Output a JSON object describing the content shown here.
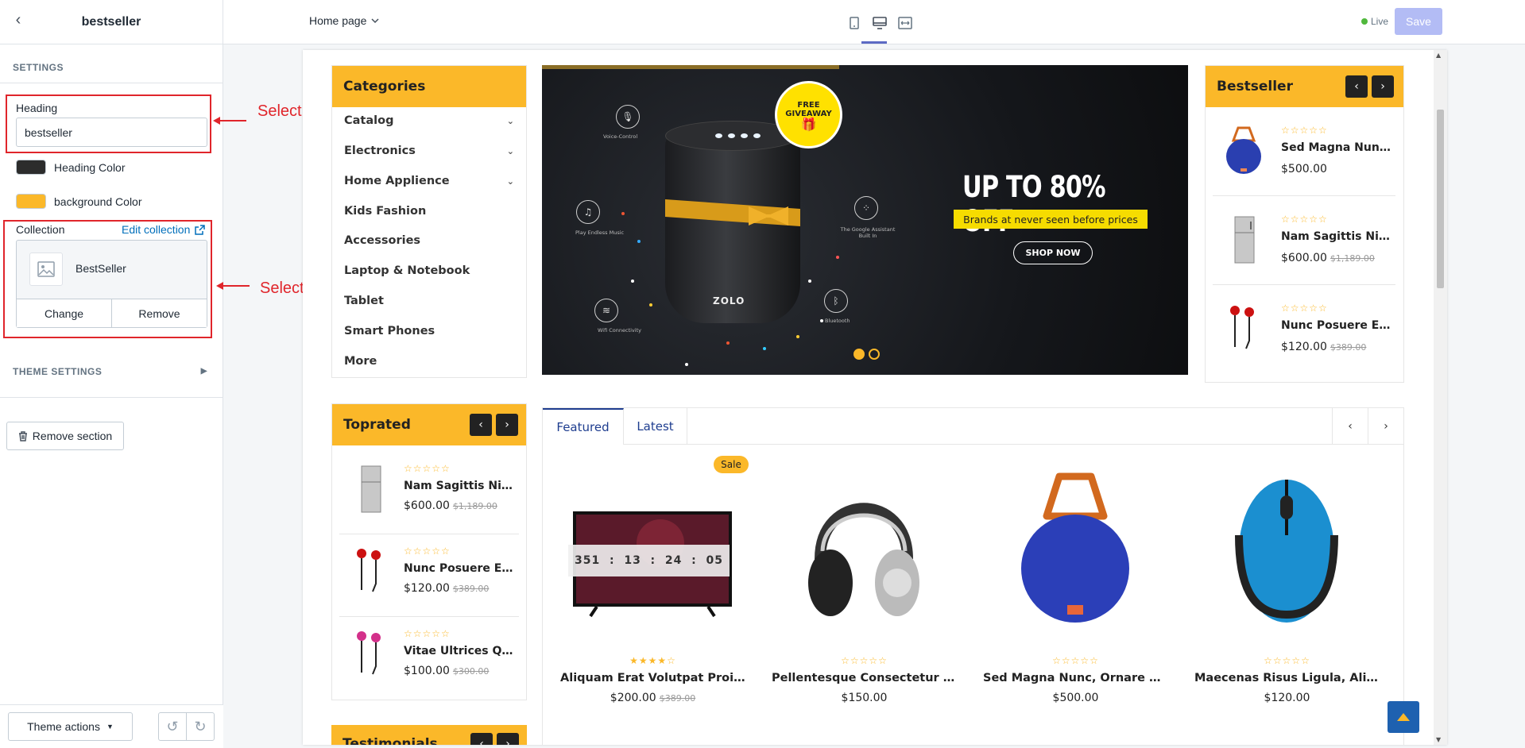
{
  "sidebar": {
    "back_icon": "chevron-left-icon",
    "title": "bestseller",
    "section_label": "SETTINGS",
    "heading_label": "Heading",
    "heading_value": "bestseller",
    "heading_color_label": "Heading Color",
    "heading_color": "#2c2c2c",
    "bg_color_label": "background Color",
    "bg_color": "#fbb829",
    "collection_label": "Collection",
    "edit_collection": "Edit collection",
    "collection_name": "BestSeller",
    "change": "Change",
    "remove": "Remove",
    "theme_settings": "THEME SETTINGS",
    "remove_section": "Remove section",
    "theme_actions": "Theme actions"
  },
  "annotations": {
    "heading": "Select Heading for product",
    "collection": "Select Collection for bestseller",
    "color": "#e0252b"
  },
  "topbar": {
    "page": "Home page",
    "live": "Live",
    "save": "Save",
    "devices": [
      "mobile-icon",
      "desktop-icon",
      "fullwidth-icon"
    ],
    "active_device": "desktop-icon",
    "accent": "#5c6ac4"
  },
  "store": {
    "accent": "#fbb829",
    "categories": {
      "title": "Categories",
      "items": [
        {
          "label": "Catalog",
          "has_sub": true
        },
        {
          "label": "Electronics",
          "has_sub": true
        },
        {
          "label": "Home Applience",
          "has_sub": true
        },
        {
          "label": "Kids Fashion",
          "has_sub": false
        },
        {
          "label": "Accessories",
          "has_sub": false
        },
        {
          "label": "Laptop & Notebook",
          "has_sub": false
        },
        {
          "label": "Tablet",
          "has_sub": false
        },
        {
          "label": "Smart Phones",
          "has_sub": false
        },
        {
          "label": "More",
          "has_sub": false
        }
      ]
    },
    "banner": {
      "giveaway_line1": "FREE",
      "giveaway_line2": "GIVEAWAY",
      "headline": "UP TO 80% OFF",
      "subline": "Brands at never seen before prices",
      "cta": "SHOP NOW",
      "brand": "ZOLO",
      "features": [
        "Voice-Control",
        "Play Endless Music",
        "Wifi Connectivity",
        "The Google Assistant Built In",
        "Bluetooth"
      ],
      "slide_count": 2,
      "active_slide": 1
    },
    "bestseller": {
      "title": "Bestseller",
      "products": [
        {
          "name": "Sed Magna Nunc, Ornare Con...",
          "price": "$500.00",
          "old_price": "",
          "rating": 0,
          "image": "jbl-speaker"
        },
        {
          "name": "Nam Sagittis Nibh Euismod",
          "price": "$600.00",
          "old_price": "$1,189.00",
          "rating": 0,
          "image": "refrigerator"
        },
        {
          "name": "Nunc Posuere Erat Viverra",
          "price": "$120.00",
          "old_price": "$389.00",
          "rating": 0,
          "image": "earphones-red"
        }
      ]
    },
    "toprated": {
      "title": "Toprated",
      "products": [
        {
          "name": "Nam Sagittis Nibh Euismod",
          "price": "$600.00",
          "old_price": "$1,189.00",
          "rating": 0,
          "image": "refrigerator"
        },
        {
          "name": "Nunc Posuere Erat Viverra",
          "price": "$120.00",
          "old_price": "$389.00",
          "rating": 0,
          "image": "earphones-red"
        },
        {
          "name": "Vitae Ultrices Quam Lorem",
          "price": "$100.00",
          "old_price": "$300.00",
          "rating": 0,
          "image": "earphones-pink"
        }
      ]
    },
    "testimonials": {
      "title": "Testimonials"
    },
    "tabs": {
      "items": [
        "Featured",
        "Latest"
      ],
      "active": "Featured",
      "products": [
        {
          "name": "Aliquam Erat Volutpat Proin Gravida",
          "price": "$200.00",
          "old_price": "$389.00",
          "rating": 4,
          "badge": "Sale",
          "image": "television",
          "countdown": [
            "351",
            "13",
            "24",
            "05"
          ]
        },
        {
          "name": "Pellentesque Consectetur Urna Nec",
          "price": "$150.00",
          "old_price": "",
          "rating": 0,
          "badge": "",
          "image": "headphones"
        },
        {
          "name": "Sed Magna Nunc, Ornare Consequat",
          "price": "$500.00",
          "old_price": "",
          "rating": 0,
          "badge": "",
          "image": "jbl-speaker"
        },
        {
          "name": "Maecenas Risus Ligula, Aliquam Vel",
          "price": "$120.00",
          "old_price": "",
          "rating": 0,
          "badge": "",
          "image": "mouse"
        }
      ]
    }
  }
}
